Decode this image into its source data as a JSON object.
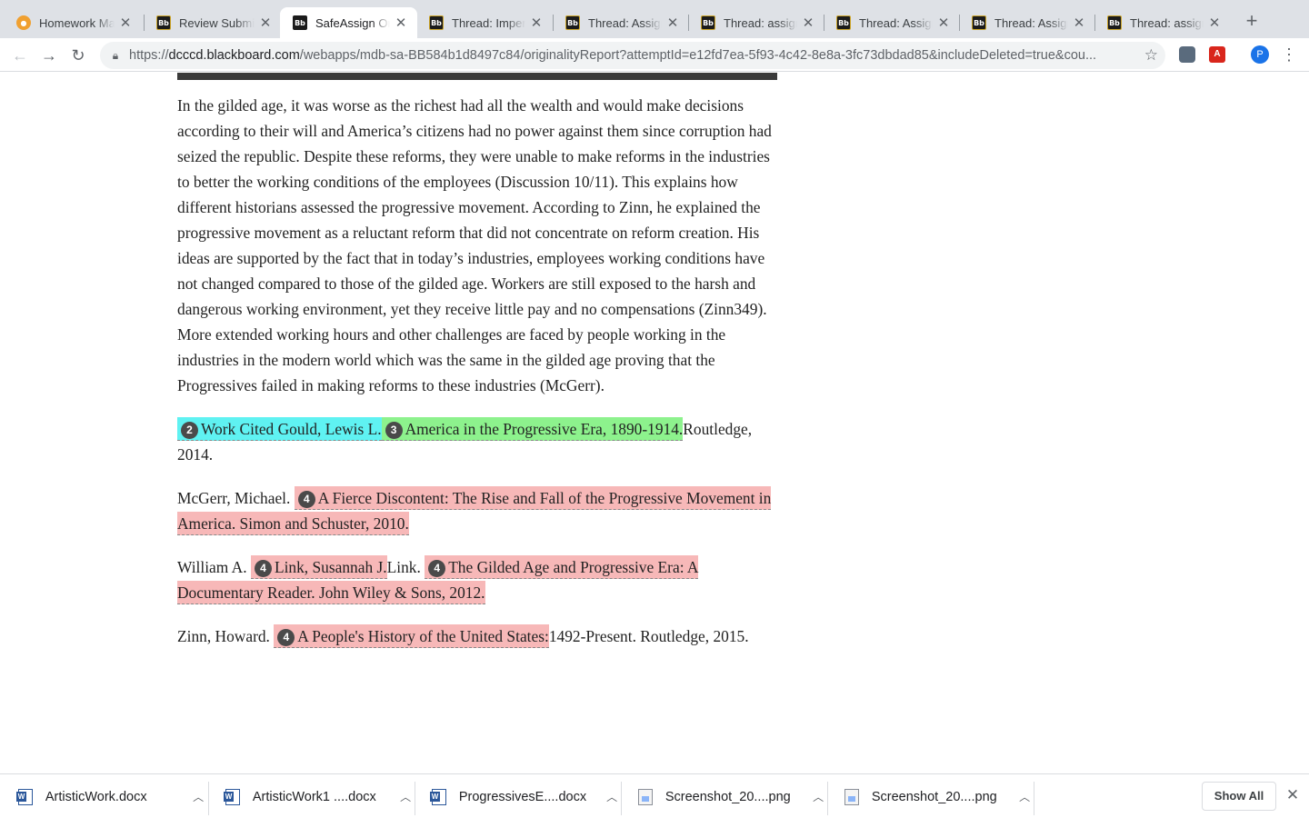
{
  "tabs": [
    {
      "title": "Homework Mar",
      "favicon": "homework-market-icon",
      "active": false
    },
    {
      "title": "Review Submis",
      "favicon": "blackboard-icon",
      "active": false
    },
    {
      "title": "SafeAssign Ori",
      "favicon": "blackboard-icon",
      "active": true
    },
    {
      "title": "Thread: Imperi",
      "favicon": "blackboard-icon",
      "active": false
    },
    {
      "title": "Thread: Assign",
      "favicon": "blackboard-icon",
      "active": false
    },
    {
      "title": "Thread: assign",
      "favicon": "blackboard-icon",
      "active": false
    },
    {
      "title": "Thread: Assign",
      "favicon": "blackboard-icon",
      "active": false
    },
    {
      "title": "Thread: Assign",
      "favicon": "blackboard-icon",
      "active": false
    },
    {
      "title": "Thread: assign",
      "favicon": "blackboard-icon",
      "active": false
    }
  ],
  "favicon_text": "Bb",
  "new_tab": "+",
  "address_bar": {
    "scheme": "https://",
    "host": "dcccd.blackboard.com",
    "path": "/webapps/mdb-sa-BB584b1d8497c84/originalityReport?attemptId=e12fd7ea-5f93-4c42-8e8a-3fc73dbdad85&includeDeleted=true&cou..."
  },
  "profile_initial": "P",
  "document": {
    "body_paragraph": "In the gilded age, it was worse as the richest had all the wealth and would make decisions according to their will and America’s citizens had no power against them since corruption had seized the republic. Despite these reforms, they were unable to make reforms in the industries to better the working conditions of the employees (Discussion 10/11). This explains how different historians assessed the progressive movement. According to Zinn, he explained the progressive movement as a reluctant reform that did not concentrate on reform creation. His ideas are supported by the fact that in today’s industries, employees working conditions have not changed compared to those of the gilded age. Workers are still exposed to the harsh and dangerous working environment, yet they receive little pay and no compensations (Zinn349). More extended working hours and other challenges are faced by people working in the industries in the modern world which was the same in the gilded age proving that the Progressives failed in making reforms to these industries (McGerr).",
    "citation_1": {
      "badge_a": "2",
      "match_a": "Work Cited Gould, Lewis L.",
      "badge_b": "3",
      "match_b": "America in the Progressive Era, 1890-1914.",
      "tail": "Routledge, 2014."
    },
    "citation_2": {
      "lead": "McGerr, Michael.",
      "badge": "4",
      "match": "A Fierce Discontent: The Rise and Fall of the Progressive Movement in America. Simon and Schuster, 2010."
    },
    "citation_3": {
      "lead": "William A.",
      "badge_a": "4",
      "match_a": "Link, Susannah J.",
      "middle": "Link.",
      "badge_b": "4",
      "match_b": "The Gilded Age and Progressive Era: A Documentary Reader. John Wiley & Sons, 2012."
    },
    "citation_4": {
      "lead": "Zinn, Howard.",
      "badge": "4",
      "match": "A People's History of the United States:",
      "tail": "1492-Present. Routledge, 2015."
    },
    "highlight_colors": {
      "source_2": "#5ff2f2",
      "source_3": "#8df28d",
      "source_4": "#f7b8b8"
    }
  },
  "downloads": [
    {
      "filename": "ArtisticWork.docx",
      "icon": "word-file-icon"
    },
    {
      "filename": "ArtisticWork1 ....docx",
      "icon": "word-file-icon"
    },
    {
      "filename": "ProgressivesE....docx",
      "icon": "word-file-icon"
    },
    {
      "filename": "Screenshot_20....png",
      "icon": "image-file-icon"
    },
    {
      "filename": "Screenshot_20....png",
      "icon": "image-file-icon"
    }
  ],
  "show_all_label": "Show All"
}
